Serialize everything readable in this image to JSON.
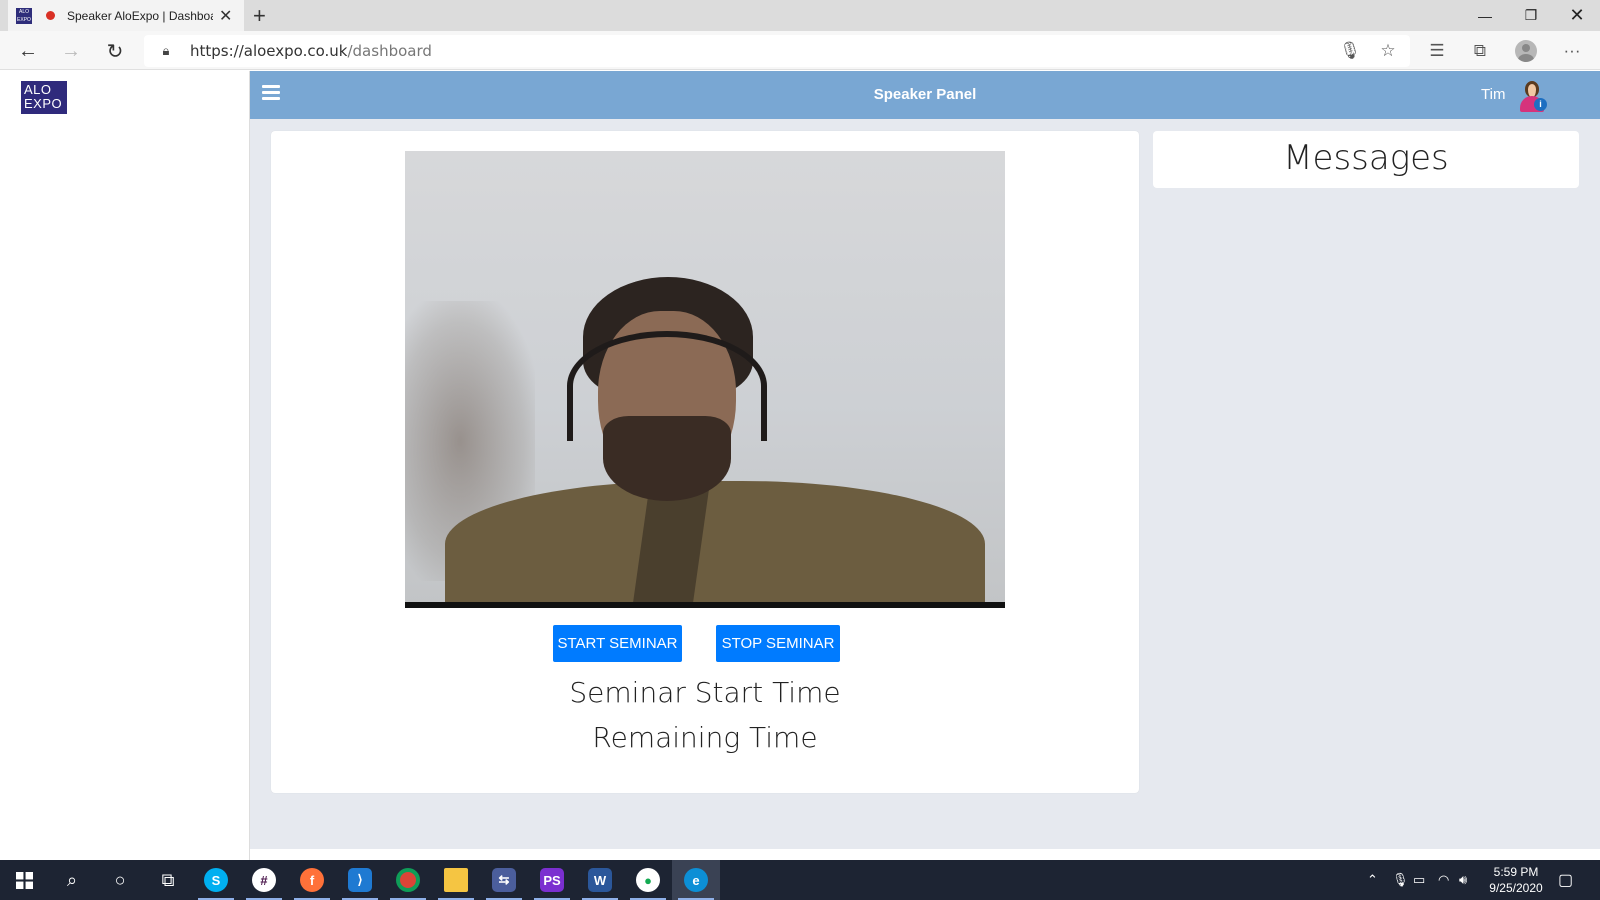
{
  "browser": {
    "tab_title": "Speaker AloExpo | Dashboa",
    "url_host": "https://aloexpo.co.uk",
    "url_path": "/dashboard",
    "favicon_text": "ALO EXPO"
  },
  "sidebar": {
    "logo_line1": "ALO",
    "logo_line2": "EXPO"
  },
  "topbar": {
    "title": "Speaker Panel",
    "user_name": "Tim",
    "avatar_badge": "i"
  },
  "seminar": {
    "start_label": "START SEMINAR",
    "stop_label": "STOP SEMINAR",
    "start_time_label": "Seminar Start Time",
    "remaining_time_label": "Remaining Time"
  },
  "messages": {
    "title": "Messages"
  },
  "taskbar": {
    "time": "5:59 PM",
    "date": "9/25/2020",
    "apps": [
      "start",
      "search",
      "cortana",
      "task-view",
      "skype",
      "slack",
      "firefox",
      "vscode",
      "chrome",
      "file-explorer",
      "network-app",
      "phpstorm",
      "word",
      "mongodb",
      "edge"
    ]
  },
  "colors": {
    "topbar": "#79a7d3",
    "button": "#007bff",
    "logo": "#2f2a7c",
    "taskbar": "#1d2433"
  }
}
